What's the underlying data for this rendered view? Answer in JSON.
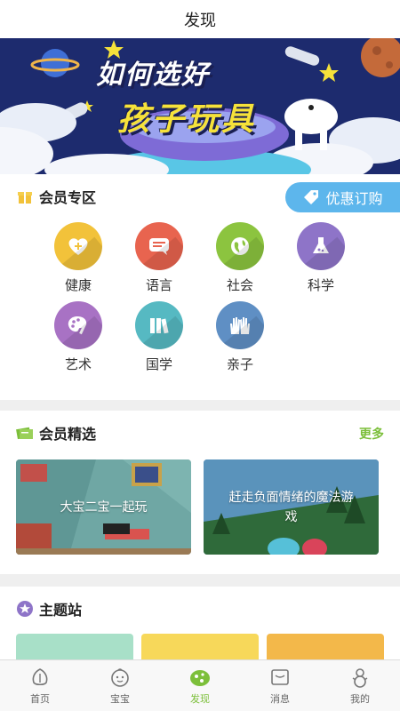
{
  "header": {
    "title": "发现"
  },
  "banner": {
    "line1": "如何选好",
    "line2": "孩子玩具"
  },
  "member_zone": {
    "title": "会员专区",
    "promo_label": "优惠订购",
    "categories": [
      {
        "label": "健康",
        "icon": "heart-plus-icon",
        "color": "#f2c23a"
      },
      {
        "label": "语言",
        "icon": "speech-bubble-icon",
        "color": "#e8644f"
      },
      {
        "label": "社会",
        "icon": "globe-icon",
        "color": "#8cc43f"
      },
      {
        "label": "科学",
        "icon": "flask-icon",
        "color": "#8e74c8"
      },
      {
        "label": "艺术",
        "icon": "palette-icon",
        "color": "#a872c4"
      },
      {
        "label": "国学",
        "icon": "books-icon",
        "color": "#56b9c2"
      },
      {
        "label": "亲子",
        "icon": "hands-icon",
        "color": "#5f8fc4"
      }
    ]
  },
  "member_picks": {
    "title": "会员精选",
    "more_label": "更多",
    "cards": [
      {
        "text": "大宝二宝一起玩"
      },
      {
        "text": "赶走负面情绪的魔法游戏"
      }
    ]
  },
  "theme_station": {
    "title": "主题站",
    "tiles": [
      {
        "color": "#a8e0c8"
      },
      {
        "color": "#f7d85a"
      },
      {
        "color": "#f3b84a"
      }
    ]
  },
  "tabbar": {
    "items": [
      {
        "label": "首页",
        "active": false
      },
      {
        "label": "宝宝",
        "active": false
      },
      {
        "label": "发现",
        "active": true
      },
      {
        "label": "消息",
        "active": false
      },
      {
        "label": "我的",
        "active": false
      }
    ]
  },
  "colors": {
    "accent": "#7cbf3a",
    "promo": "#5db6ec"
  }
}
